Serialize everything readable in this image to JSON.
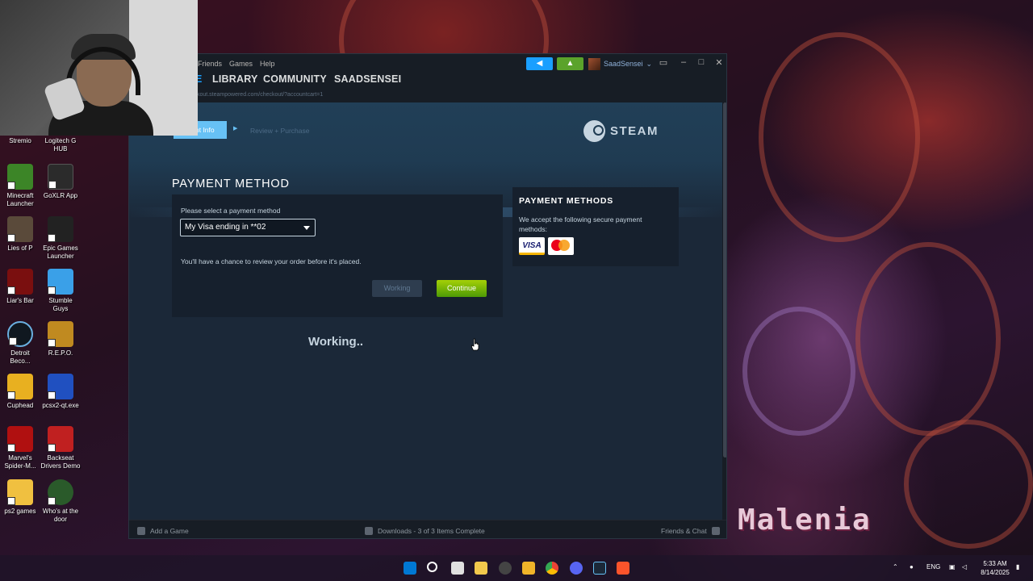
{
  "desktop": {
    "icons": [
      {
        "label": "Stremio",
        "color": "#6b2cb7"
      },
      {
        "label": "Logitech G HUB",
        "color": "#00b8fc"
      },
      {
        "label": "Minecraft Launcher",
        "color": "#3c8527"
      },
      {
        "label": "GoXLR App",
        "color": "#2b2b2b"
      },
      {
        "label": "Lies of P",
        "color": "#5a4a3a"
      },
      {
        "label": "Epic Games Launcher",
        "color": "#222222"
      },
      {
        "label": "Liar's Bar",
        "color": "#7a0f0f"
      },
      {
        "label": "Stumble Guys",
        "color": "#3aa0e8"
      },
      {
        "label": "Detroit Beco...",
        "color": "#101820"
      },
      {
        "label": "R.E.P.O.",
        "color": "#c08a20"
      },
      {
        "label": "Cuphead",
        "color": "#e8b020"
      },
      {
        "label": "pcsx2-qt.exe",
        "color": "#2050c0"
      },
      {
        "label": "Marvel's Spider-M...",
        "color": "#b01010"
      },
      {
        "label": "Backseat Drivers Demo",
        "color": "#c02020"
      },
      {
        "label": "ps2 games",
        "color": "#f0c040"
      },
      {
        "label": "Who's at the door",
        "color": "#2a5a2a"
      }
    ],
    "wallpaper_text": "Malenia"
  },
  "steam": {
    "menu": [
      "Friends",
      "Games",
      "Help"
    ],
    "announce_icon": "megaphone-icon",
    "notify_icon": "bell-icon",
    "username": "SaadSensei",
    "nav": {
      "partial": "E",
      "library": "LIBRARY",
      "community": "COMMUNITY",
      "profile": "SAADSENSEI"
    },
    "url": "kout.steampowered.com/checkout/?accountcart=1",
    "steps": {
      "active": "nt Info",
      "next": "Review + Purchase"
    },
    "logo_text": "STEAM",
    "payment": {
      "title": "PAYMENT METHOD",
      "select_label": "Please select a payment method",
      "selected_method": "My Visa ending in **02",
      "note": "You'll have a chance to review your order before it's placed.",
      "working_button": "Working",
      "continue_button": "Continue"
    },
    "side": {
      "title": "PAYMENT METHODS",
      "text": "We accept the following secure payment methods:",
      "visa": "VISA"
    },
    "status": "Working..",
    "footer": {
      "add_game": "Add a Game",
      "downloads": "Downloads - 3 of 3 Items Complete",
      "friends": "Friends & Chat"
    }
  },
  "taskbar": {
    "lang": "ENG",
    "time": "5:33 AM",
    "date": "8/14/2025"
  },
  "colors": {
    "steam_blue": "#67c1f5",
    "continue_green": "#5ba32b",
    "panel_bg": "#16202d",
    "page_bg": "#1b2838"
  }
}
